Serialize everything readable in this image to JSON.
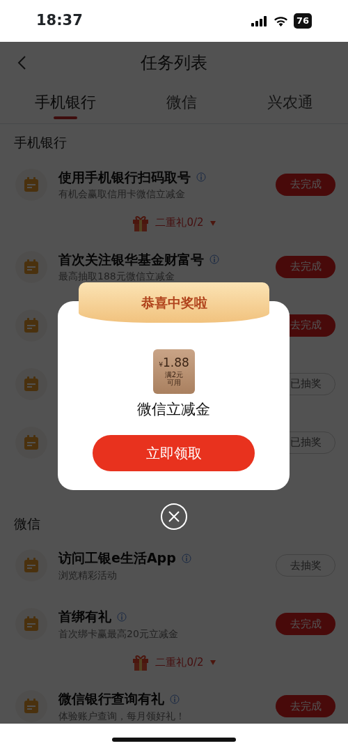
{
  "status_bar": {
    "time": "18:37",
    "battery": "76"
  },
  "header": {
    "title": "任务列表"
  },
  "tabs": [
    {
      "label": "手机银行",
      "selected": true
    },
    {
      "label": "微信",
      "selected": false
    },
    {
      "label": "兴农通",
      "selected": false
    }
  ],
  "sections": [
    {
      "title": "手机银行",
      "tasks": [
        {
          "title": "使用手机银行扫码取号",
          "subtitle": "有机会赢取信用卡微信立减金",
          "button": {
            "label": "去完成",
            "kind": "primary"
          },
          "bonus": "二重礼0/2"
        },
        {
          "title": "首次关注银华基金财富号",
          "subtitle": "最高抽取188元微信立减金",
          "button": {
            "label": "去完成",
            "kind": "primary"
          }
        },
        {
          "button": {
            "label": "去完成",
            "kind": "primary"
          }
        },
        {
          "button": {
            "label": "已抽奖",
            "kind": "outline"
          }
        },
        {
          "button": {
            "label": "已抽奖",
            "kind": "outline"
          }
        }
      ]
    },
    {
      "title": "微信",
      "tasks": [
        {
          "title": "访问工银e生活App",
          "subtitle": "浏览精彩活动",
          "button": {
            "label": "去抽奖",
            "kind": "outline"
          }
        },
        {
          "title": "首绑有礼",
          "subtitle": "首次绑卡赢最高20元立减金",
          "button": {
            "label": "去完成",
            "kind": "primary"
          },
          "bonus": "二重礼0/2"
        },
        {
          "title": "微信银行查询有礼",
          "subtitle": "体验账户查询，每月领好礼！",
          "button": {
            "label": "去完成",
            "kind": "primary"
          }
        }
      ]
    }
  ],
  "modal": {
    "ribbon": "恭喜中奖啦",
    "coupon": {
      "currency": "¥",
      "amount": "1.88",
      "condition_lines": [
        "满2元",
        "可用"
      ]
    },
    "prize_name": "微信立减金",
    "claim_button": "立即领取"
  }
}
